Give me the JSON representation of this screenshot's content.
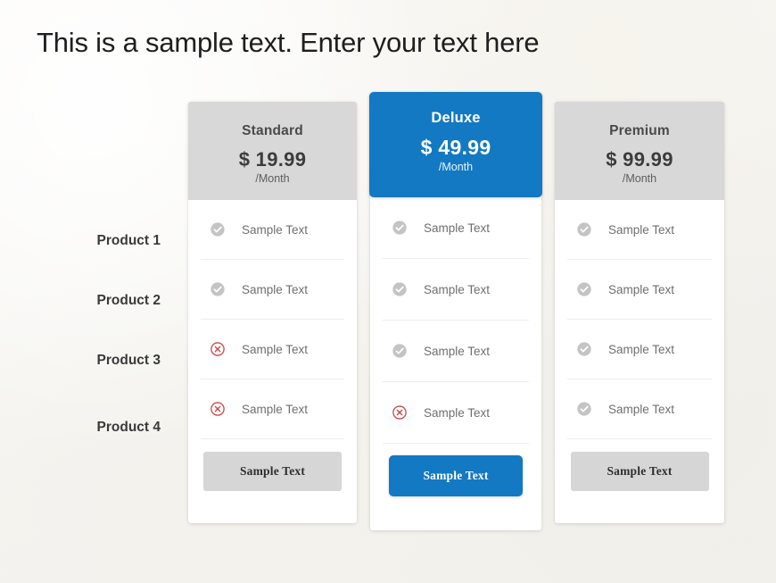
{
  "title": "This is a sample text. Enter your text here",
  "theme": {
    "accent_blue": "#1379c3",
    "header_gray": "#d8d8d8",
    "button_gray": "#d6d6d6",
    "check_gray": "#c4c4c4",
    "cross_red": "#c94b4b",
    "background": "#f7f6f3",
    "title_color": "#1f1f1f",
    "feature_text_color": "#6f6f6f"
  },
  "products": [
    {
      "label": "Product 1"
    },
    {
      "label": "Product 2"
    },
    {
      "label": "Product 3"
    },
    {
      "label": "Product 4"
    }
  ],
  "plans": [
    {
      "id": "standard",
      "name": "Standard",
      "price": "$ 19.99",
      "period": "/Month",
      "highlight": false,
      "features": [
        {
          "text": "Sample Text",
          "icon": "check-circle-icon",
          "included": true
        },
        {
          "text": "Sample Text",
          "icon": "check-circle-icon",
          "included": true
        },
        {
          "text": "Sample Text",
          "icon": "cross-circle-icon",
          "included": false
        },
        {
          "text": "Sample Text",
          "icon": "cross-circle-icon",
          "included": false
        }
      ],
      "cta_label": "Sample Text"
    },
    {
      "id": "deluxe",
      "name": "Deluxe",
      "price": "$ 49.99",
      "period": "/Month",
      "highlight": true,
      "features": [
        {
          "text": "Sample Text",
          "icon": "check-circle-icon",
          "included": true
        },
        {
          "text": "Sample Text",
          "icon": "check-circle-icon",
          "included": true
        },
        {
          "text": "Sample Text",
          "icon": "check-circle-icon",
          "included": true
        },
        {
          "text": "Sample Text",
          "icon": "cross-circle-icon",
          "included": false
        }
      ],
      "cta_label": "Sample Text"
    },
    {
      "id": "premium",
      "name": "Premium",
      "price": "$ 99.99",
      "period": "/Month",
      "highlight": false,
      "features": [
        {
          "text": "Sample Text",
          "icon": "check-circle-icon",
          "included": true
        },
        {
          "text": "Sample Text",
          "icon": "check-circle-icon",
          "included": true
        },
        {
          "text": "Sample Text",
          "icon": "check-circle-icon",
          "included": true
        },
        {
          "text": "Sample Text",
          "icon": "check-circle-icon",
          "included": true
        }
      ],
      "cta_label": "Sample Text"
    }
  ]
}
